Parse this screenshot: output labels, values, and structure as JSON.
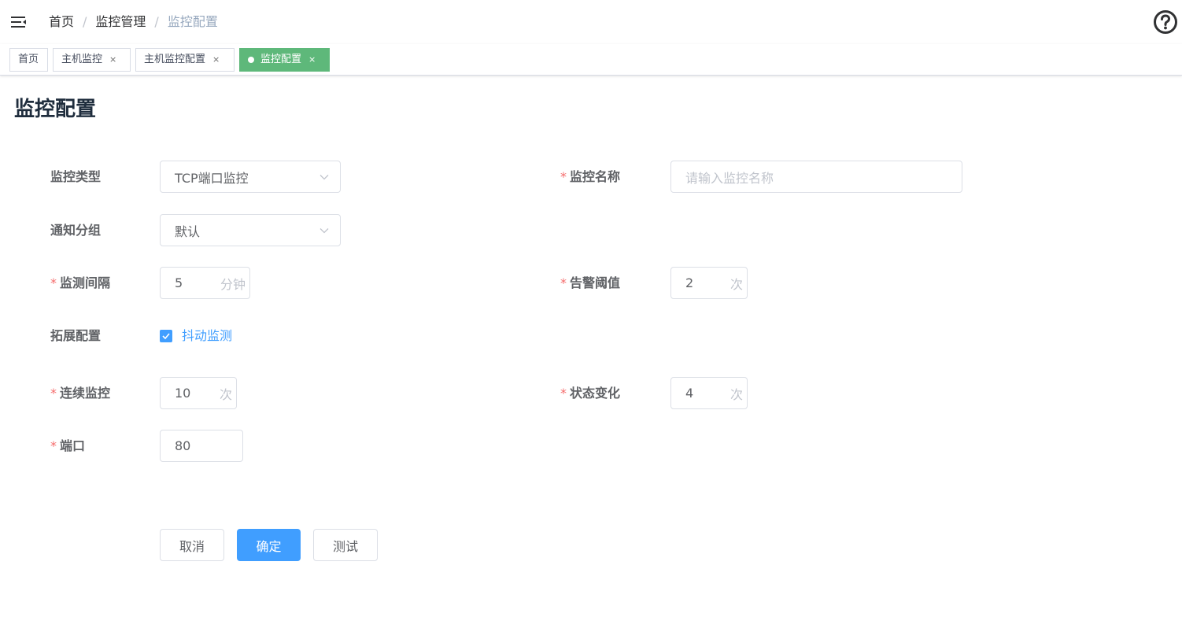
{
  "navbar": {
    "menu_icon": "hamburger-fold-icon",
    "breadcrumb": [
      "首页",
      "监控管理",
      "监控配置"
    ],
    "separator": "/",
    "help_icon": "question-circle-icon"
  },
  "tags": [
    {
      "label": "首页",
      "closable": false,
      "active": false
    },
    {
      "label": "主机监控",
      "closable": true,
      "active": false
    },
    {
      "label": "主机监控配置",
      "closable": true,
      "active": false
    },
    {
      "label": "监控配置",
      "closable": true,
      "active": true
    }
  ],
  "tag_close_glyph": "×",
  "page": {
    "title": "监控配置"
  },
  "form": {
    "monitor_type": {
      "label": "监控类型",
      "value": "TCP端口监控"
    },
    "monitor_name": {
      "label": "监控名称",
      "placeholder": "请输入监控名称"
    },
    "notify_group": {
      "label": "通知分组",
      "value": "默认"
    },
    "check_interval": {
      "label": "监测间隔",
      "value": "5",
      "unit": "分钟"
    },
    "alert_threshold": {
      "label": "告警阈值",
      "value": "2",
      "unit": "次"
    },
    "extension": {
      "label": "拓展配置",
      "checkbox_label": "抖动监测",
      "checked": true
    },
    "consecutive": {
      "label": "连续监控",
      "value": "10",
      "unit": "次"
    },
    "state_change": {
      "label": "状态变化",
      "value": "4",
      "unit": "次"
    },
    "port": {
      "label": "端口",
      "value": "80"
    },
    "required_mark": "*"
  },
  "buttons": {
    "cancel": "取消",
    "confirm": "确定",
    "test": "测试"
  },
  "colors": {
    "primary": "#409eff",
    "active_tag": "#5eb87a",
    "required": "#f56c6c"
  }
}
